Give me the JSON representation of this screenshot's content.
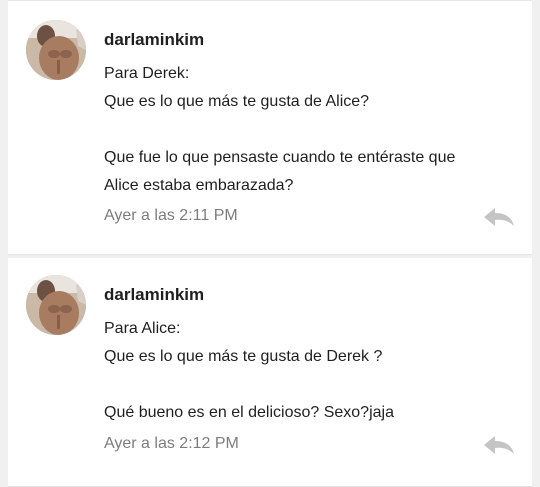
{
  "comments": [
    {
      "username": "darlaminkim",
      "lines": [
        "Para Derek:",
        "Que es lo que más te gusta de Alice?",
        "",
        "Que fue lo que pensaste cuando te entéraste que",
        "Alice estaba embarazada?"
      ],
      "timestamp": "Ayer a las 2:11 PM",
      "avatar_icon": "user-avatar-photo",
      "reply_icon": "reply-arrow-icon"
    },
    {
      "username": "darlaminkim",
      "lines": [
        "Para Alice:",
        "Que es lo que más te gusta de Derek ?",
        "",
        "Qué bueno es en el delicioso? Sexo?jaja"
      ],
      "timestamp": "Ayer a las 2:12 PM",
      "avatar_icon": "user-avatar-photo",
      "reply_icon": "reply-arrow-icon"
    }
  ],
  "colors": {
    "background": "#f0f0f0",
    "card": "#ffffff",
    "text": "#1f1f1f",
    "timestamp": "#7d7d7d",
    "reply_icon": "#c4c4c4"
  }
}
